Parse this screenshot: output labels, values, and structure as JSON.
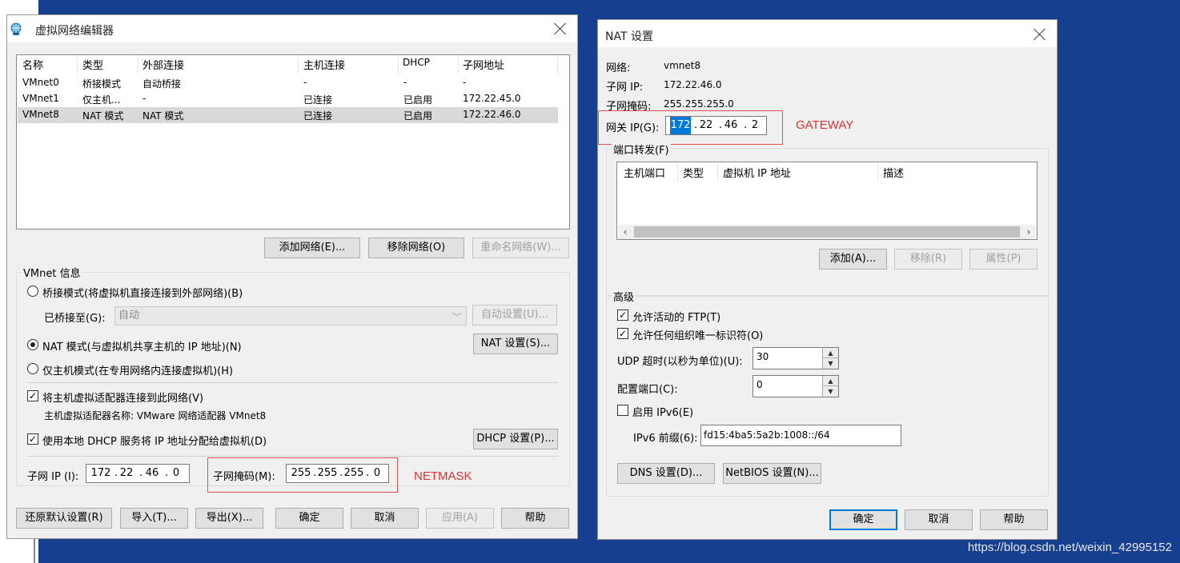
{
  "vne": {
    "title": "虚拟网络编辑器",
    "columns": [
      "名称",
      "类型",
      "外部连接",
      "主机连接",
      "DHCP",
      "子网地址"
    ],
    "rows": [
      [
        "VMnet0",
        "桥接模式",
        "自动桥接",
        "-",
        "-",
        "-"
      ],
      [
        "VMnet1",
        "仅主机...",
        "-",
        "已连接",
        "已启用",
        "172.22.45.0"
      ],
      [
        "VMnet8",
        "NAT 模式",
        "NAT 模式",
        "已连接",
        "已启用",
        "172.22.46.0"
      ]
    ],
    "add_network": "添加网络(E)...",
    "remove_network": "移除网络(O)",
    "rename_network": "重命名网络(W)...",
    "vmnet_info": "VMnet 信息",
    "bridge_mode": "桥接模式(将虚拟机直接连接到外部网络)(B)",
    "bridged_to": "已桥接至(G):",
    "bridged_value": "自动",
    "auto_settings": "自动设置(U)...",
    "nat_mode": "NAT 模式(与虚拟机共享主机的 IP 地址)(N)",
    "nat_settings": "NAT 设置(S)...",
    "hostonly_mode": "仅主机模式(在专用网络内连接虚拟机)(H)",
    "connect_adapter": "将主机虚拟适配器连接到此网络(V)",
    "adapter_name": "主机虚拟适配器名称: VMware 网络适配器 VMnet8",
    "use_dhcp": "使用本地 DHCP 服务将 IP 地址分配给虚拟机(D)",
    "dhcp_settings": "DHCP 设置(P)...",
    "subnet_ip_label": "子网 IP (I):",
    "subnet_ip": [
      "172",
      "22",
      "46",
      "0"
    ],
    "subnet_mask_label": "子网掩码(M):",
    "subnet_mask": [
      "255",
      "255",
      "255",
      "0"
    ],
    "netmask_annotation": "NETMASK",
    "restore_defaults": "还原默认设置(R)",
    "import": "导入(T)...",
    "export": "导出(X)...",
    "ok": "确定",
    "cancel": "取消",
    "apply": "应用(A)",
    "help": "帮助"
  },
  "nat": {
    "title": "NAT 设置",
    "network_label": "网络:",
    "network_value": "vmnet8",
    "subnet_ip_label": "子网 IP:",
    "subnet_ip_value": "172.22.46.0",
    "subnet_mask_label": "子网掩码:",
    "subnet_mask_value": "255.255.255.0",
    "gateway_label": "网关 IP(G):",
    "gateway_ip": [
      "172",
      "22",
      "46",
      "2"
    ],
    "gateway_annotation": "GATEWAY",
    "port_forwarding": "端口转发(F)",
    "pf_columns": [
      "主机端口",
      "类型",
      "虚拟机 IP 地址",
      "描述"
    ],
    "add": "添加(A)...",
    "remove": "移除(R)",
    "properties": "属性(P)",
    "advanced": "高级",
    "allow_ftp": "允许活动的 FTP(T)",
    "allow_uid": "允许任何组织唯一标识符(O)",
    "udp_timeout_label": "UDP 超时(以秒为单位)(U):",
    "udp_timeout_value": "30",
    "config_port_label": "配置端口(C):",
    "config_port_value": "0",
    "enable_ipv6": "启用 IPv6(E)",
    "ipv6_prefix_label": "IPv6 前缀(6):",
    "ipv6_prefix_value": "fd15:4ba5:5a2b:1008::/64",
    "dns_settings": "DNS 设置(D)...",
    "netbios_settings": "NetBIOS 设置(N)...",
    "ok": "确定",
    "cancel": "取消",
    "help": "帮助"
  },
  "watermark": "https://blog.csdn.net/weixin_42995152",
  "colors": {
    "desktop": "#173f8f",
    "accent": "#0078d7",
    "annotation": "#e03030"
  }
}
